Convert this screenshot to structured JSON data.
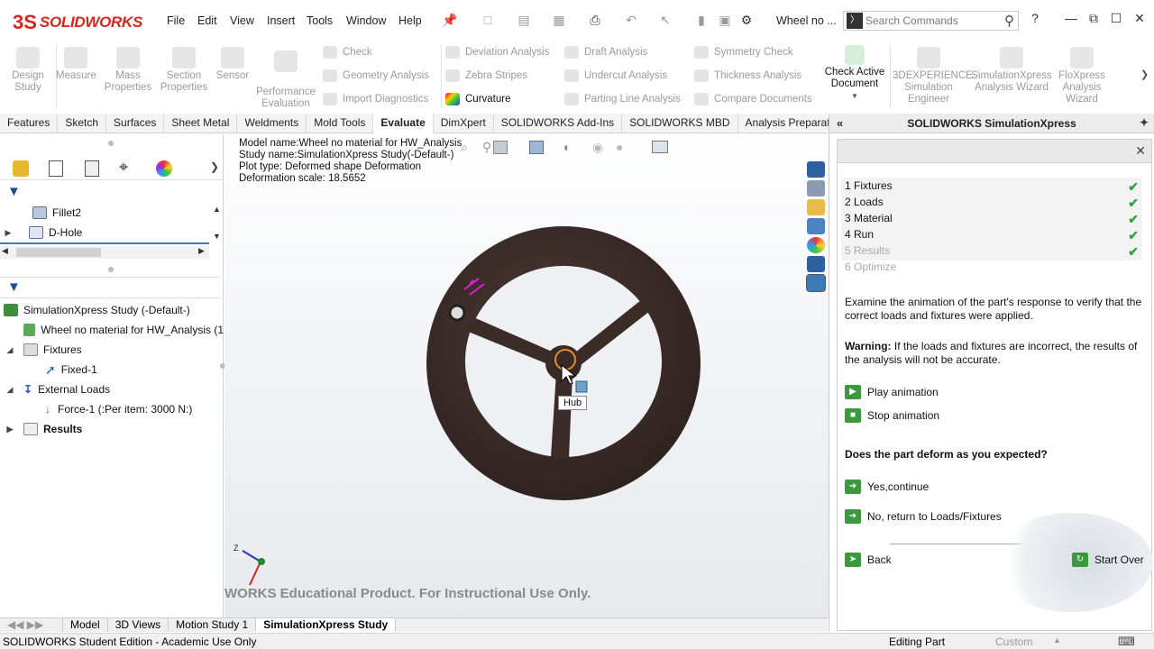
{
  "app": {
    "logo_mark": "3S",
    "logo_text": "SOLIDWORKS",
    "menus": [
      "File",
      "Edit",
      "View",
      "Insert",
      "Tools",
      "Window",
      "Help"
    ],
    "doc_title": "Wheel no ...",
    "search_placeholder": "Search Commands",
    "help_glyph": "?"
  },
  "ribbon": {
    "large_buttons": [
      {
        "label_1": "Design",
        "label_2": "Study"
      },
      {
        "label_1": "Measure",
        "label_2": ""
      },
      {
        "label_1": "Mass",
        "label_2": "Properties"
      },
      {
        "label_1": "Section",
        "label_2": "Properties"
      },
      {
        "label_1": "Sensor",
        "label_2": ""
      },
      {
        "label_1": "Performance",
        "label_2": "Evaluation"
      }
    ],
    "col1": [
      "Check",
      "Geometry Analysis",
      "Import Diagnostics"
    ],
    "col2": [
      "Deviation Analysis",
      "Zebra Stripes",
      "Curvature"
    ],
    "col3": [
      "Draft Analysis",
      "Undercut Analysis",
      "Parting Line Analysis"
    ],
    "col4": [
      "Symmetry Check",
      "Thickness Analysis",
      "Compare Documents"
    ],
    "check_active": {
      "label_1": "Check Active",
      "label_2": "Document"
    },
    "right_buttons": [
      {
        "label_1": "3DEXPERIENCE",
        "label_2": "Simulation",
        "label_3": "Engineer"
      },
      {
        "label_1": "SimulationXpress",
        "label_2": "Analysis Wizard",
        "label_3": ""
      },
      {
        "label_1": "FloXpress",
        "label_2": "Analysis",
        "label_3": "Wizard"
      }
    ]
  },
  "command_tabs": [
    "Features",
    "Sketch",
    "Surfaces",
    "Sheet Metal",
    "Weldments",
    "Mold Tools",
    "Evaluate",
    "DimXpert",
    "SOLIDWORKS Add-Ins",
    "SOLIDWORKS MBD",
    "Analysis Preparation"
  ],
  "active_tab": "Evaluate",
  "feature_tree": {
    "items": [
      "Fillet2",
      "D-Hole"
    ]
  },
  "sim_tree": {
    "study": "SimulationXpress Study (-Default-)",
    "part": "Wheel no material for HW_Analysis (1",
    "fixtures": "Fixtures",
    "fixed": "Fixed-1",
    "external_loads": "External Loads",
    "force": "Force-1 (:Per item: 3000 N:)",
    "results": "Results"
  },
  "viewport": {
    "info": [
      "Model name:Wheel no material for HW_Analysis",
      "Study name:SimulationXpress Study(-Default-)",
      "Plot type: Deformed shape Deformation",
      "Deformation scale: 18.5652"
    ],
    "hub_label": "Hub",
    "watermark": "WORKS Educational Product. For Instructional Use Only.",
    "axis_z": "Z"
  },
  "taskpane": {
    "title": "SOLIDWORKS SimulationXpress",
    "steps": [
      {
        "num": "1",
        "label": "Fixtures",
        "done": true
      },
      {
        "num": "2",
        "label": "Loads",
        "done": true
      },
      {
        "num": "3",
        "label": "Material",
        "done": true
      },
      {
        "num": "4",
        "label": "Run",
        "done": true
      },
      {
        "num": "5",
        "label": "Results",
        "done": true
      },
      {
        "num": "6",
        "label": "Optimize",
        "done": false
      }
    ],
    "instruction": "Examine the animation of the part's response to verify that the correct loads and fixtures were applied.",
    "warning_label": "Warning:",
    "warning_text": " If the loads and fixtures are incorrect, the results of the analysis will not be accurate.",
    "play": "Play animation",
    "stop": "Stop animation",
    "question": "Does the part deform as you expected?",
    "yes": "Yes,continue",
    "no": "No, return to Loads/Fixtures",
    "back": "Back",
    "start_over": "Start Over"
  },
  "bottom_tabs": [
    "Model",
    "3D Views",
    "Motion Study 1",
    "SimulationXpress Study"
  ],
  "status": {
    "left": "SOLIDWORKS Student Edition - Academic Use Only",
    "mode": "Editing Part",
    "units": "Custom"
  },
  "colors": {
    "brand_red": "#d9261c",
    "wheel": "#3e2e2a",
    "check_green": "#2fa637",
    "action_green": "#3b9a3e"
  }
}
